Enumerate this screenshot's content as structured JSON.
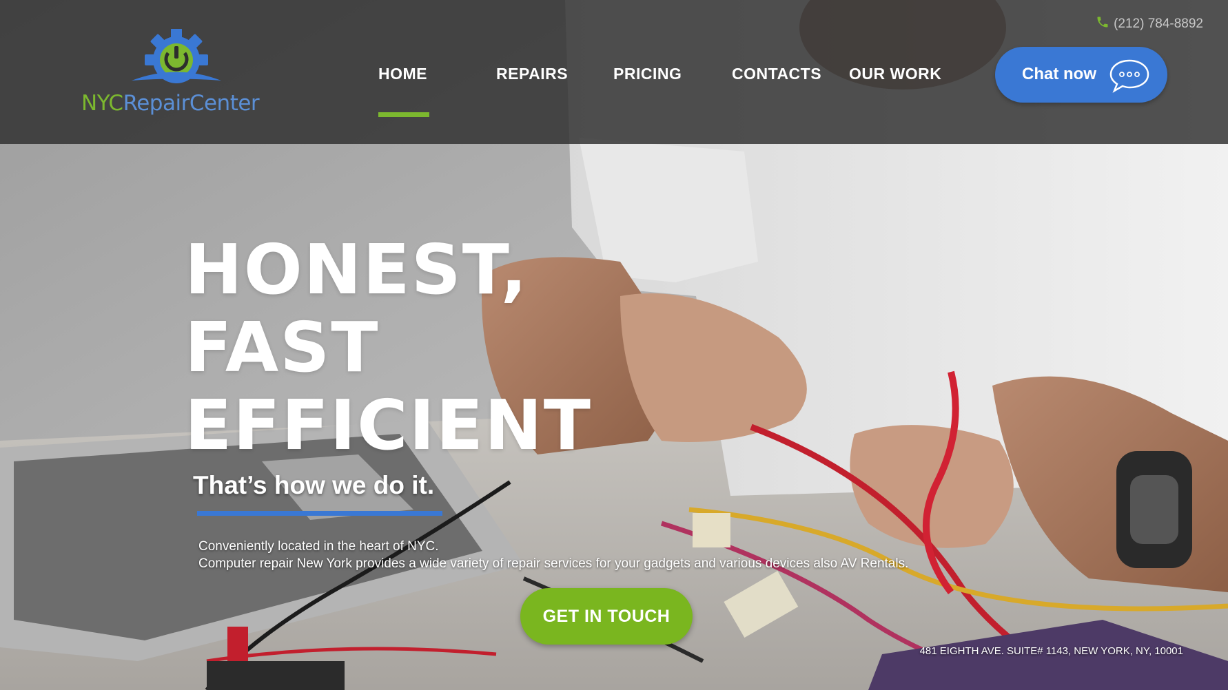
{
  "header": {
    "logo": {
      "word1": "NYC",
      "word2": "RepairCenter"
    },
    "phone": "(212) 784-8892",
    "nav": [
      "HOME",
      "REPAIRS",
      "PRICING",
      "CONTACTS",
      "OUR WORK"
    ],
    "active_nav": "HOME",
    "chat_label": "Chat now"
  },
  "hero": {
    "headline": [
      "HONEST,",
      "FAST",
      "EFFICIENT"
    ],
    "tagline": "That’s how we do it.",
    "description": [
      "Conveniently located in the heart of NYC.",
      "Computer repair New York provides a wide variety of repair services for your gadgets and various devices also AV Rentals."
    ],
    "cta_label": "GET IN TOUCH",
    "address": "481 EIGHTH AVE. SUITE# 1143,  NEW YORK, NY, 10001"
  },
  "colors": {
    "accent_green": "#7cb82f",
    "accent_blue": "#3a78d4",
    "header_bg": "#2d2d2d"
  },
  "icons": [
    "phone-icon",
    "chat-bubble-icon",
    "gear-power-logo-icon"
  ]
}
